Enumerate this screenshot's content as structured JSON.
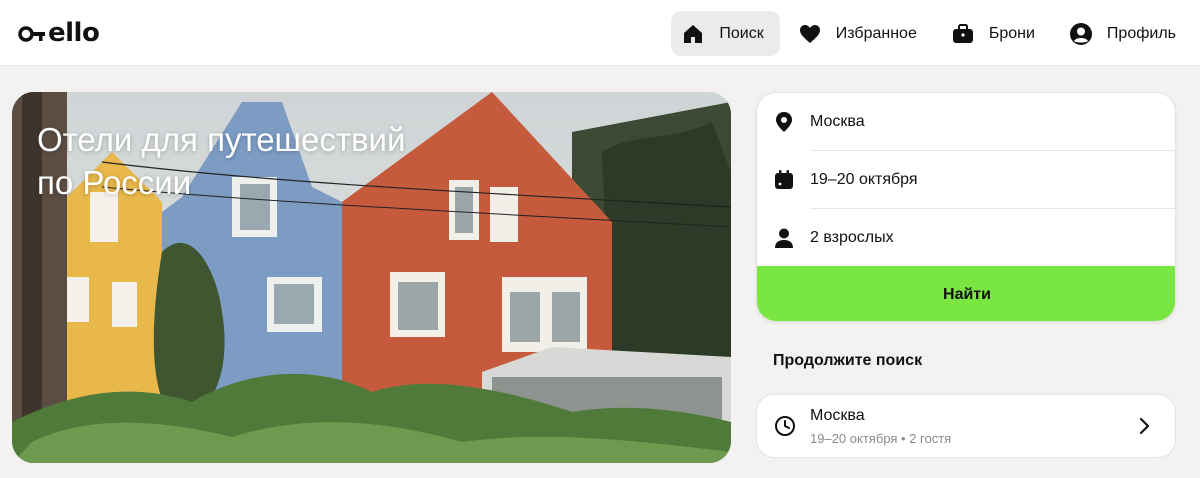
{
  "brand": {
    "logo": "o-ello"
  },
  "nav": {
    "items": [
      {
        "label": "Поиск",
        "icon": "home-icon",
        "active": true
      },
      {
        "label": "Избранное",
        "icon": "heart-icon"
      },
      {
        "label": "Брони",
        "icon": "suitcase-icon"
      },
      {
        "label": "Профиль",
        "icon": "profile-icon"
      }
    ]
  },
  "hero": {
    "title_line1": "Отели для путешествий",
    "title_line2": "по России"
  },
  "search": {
    "city": "Москва",
    "dates": "19–20 октября",
    "guests": "2 взрослых",
    "button": "Найти"
  },
  "continue": {
    "title": "Продолжите поиск",
    "recent": {
      "city": "Москва",
      "dates": "19–20 октября",
      "separator": "•",
      "guests": "2 гостя"
    }
  },
  "colors": {
    "accent": "#7ae642",
    "background": "#f3f2f0",
    "text": "#111111",
    "muted": "#8a8a8a"
  }
}
